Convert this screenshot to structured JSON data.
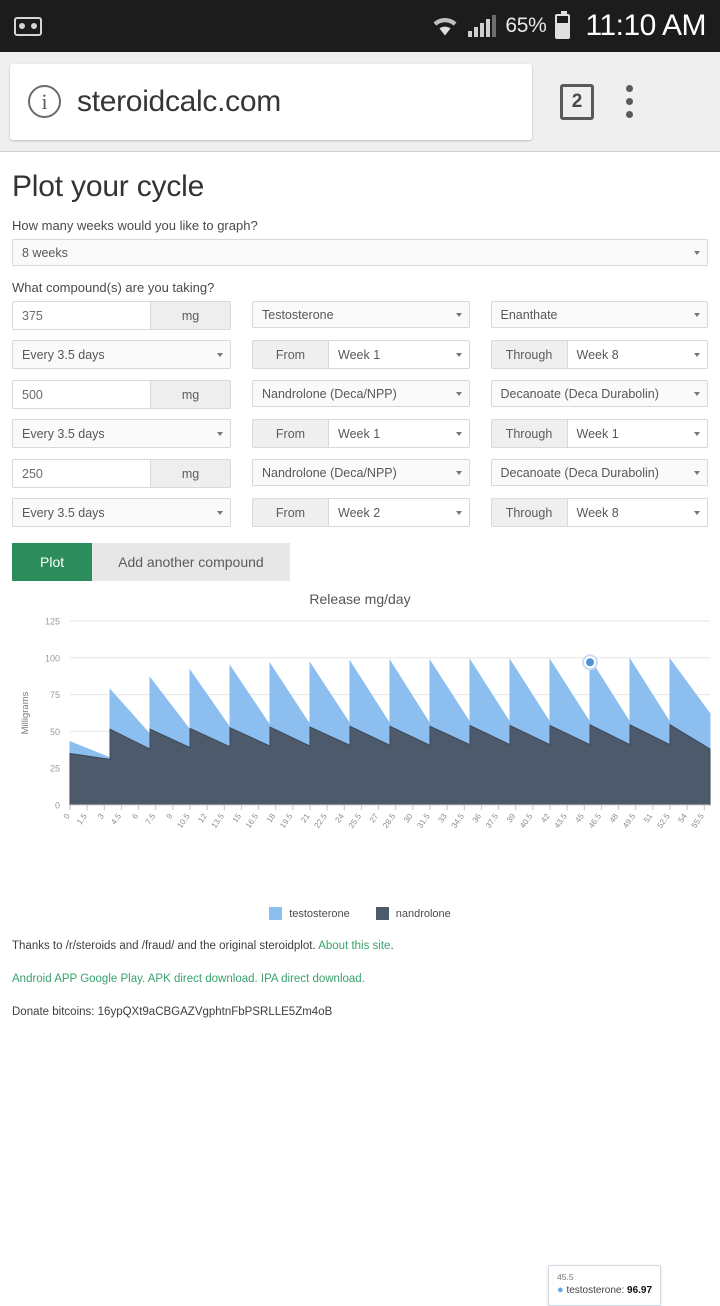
{
  "statusbar": {
    "voicemail_icon": "voicemail-icon",
    "wifi_icon": "wifi-icon",
    "signal_icon": "cell-signal-icon",
    "battery_percent": "65%",
    "battery_icon": "battery-icon",
    "time": "11:10 AM"
  },
  "browser": {
    "info_icon": "info-icon",
    "url": "steroidcalc.com",
    "tab_count": "2",
    "menu_icon": "overflow-menu-icon"
  },
  "page": {
    "title": "Plot your cycle",
    "weeks_question": "How many weeks would you like to graph?",
    "weeks_value": "8 weeks",
    "compound_question": "What compound(s) are you taking?"
  },
  "compounds": [
    {
      "dose": "375",
      "unit": "mg",
      "compound": "Testosterone",
      "ester": "Enanthate",
      "schedule": "Every 3.5 days",
      "from_label": "From",
      "from_week": "Week 1",
      "through_label": "Through",
      "through_week": "Week 8"
    },
    {
      "dose": "500",
      "unit": "mg",
      "compound": "Nandrolone (Deca/NPP)",
      "ester": "Decanoate (Deca Durabolin)",
      "schedule": "Every 3.5 days",
      "from_label": "From",
      "from_week": "Week 1",
      "through_label": "Through",
      "through_week": "Week 1"
    },
    {
      "dose": "250",
      "unit": "mg",
      "compound": "Nandrolone (Deca/NPP)",
      "ester": "Decanoate (Deca Durabolin)",
      "schedule": "Every 3.5 days",
      "from_label": "From",
      "from_week": "Week 2",
      "through_label": "Through",
      "through_week": "Week 8"
    }
  ],
  "buttons": {
    "plot": "Plot",
    "add_compound": "Add another compound",
    "plot_color": "#2c8c5c"
  },
  "tooltip": {
    "x_value": "45.5",
    "series_label": "testosterone:",
    "series_value": "96.97"
  },
  "footer": {
    "line1_pre": "Thanks to /r/steroids and /fraud/ and the original steroidplot. ",
    "line1_link": "About this site",
    "line1_post": ".",
    "line2": "Android APP Google Play. APK direct download. IPA direct download.",
    "line3": "Donate bitcoins: 16ypQXt9aCBGAZVgphtnFbPSRLLE5Zm4oB",
    "link_color": "#39a26b"
  },
  "chart_data": {
    "type": "area",
    "stacked": true,
    "title": "Release mg/day",
    "xlabel": "",
    "ylabel": "Milligrams",
    "ylim": [
      0,
      125
    ],
    "yticks": [
      0,
      25,
      50,
      75,
      100,
      125
    ],
    "xlim": [
      0,
      56
    ],
    "xticks": [
      0,
      1.5,
      3,
      4.5,
      6,
      7.5,
      9,
      10.5,
      12,
      13.5,
      15,
      16.5,
      18,
      19.5,
      21,
      22.5,
      24,
      25.5,
      27,
      28.5,
      30,
      31.5,
      33,
      34.5,
      36,
      37.5,
      39,
      40.5,
      42,
      43.5,
      45,
      46.5,
      48,
      49.5,
      51,
      52.5,
      54,
      55.5
    ],
    "grid": true,
    "legend_position": "bottom",
    "colors": {
      "testosterone": "#8cbef0",
      "nandrolone": "#4d5a6b"
    },
    "series": [
      {
        "name": "nandrolone",
        "color": "#4d5a6b",
        "x": [
          0,
          3.5,
          3.5,
          7,
          7,
          10.5,
          10.5,
          14,
          14,
          17.5,
          17.5,
          21,
          21,
          24.5,
          24.5,
          28,
          28,
          31.5,
          31.5,
          35,
          35,
          38.5,
          38.5,
          42,
          42,
          45.5,
          45.5,
          49,
          49,
          52.5,
          52.5,
          56
        ],
        "y": [
          35,
          31,
          51.5,
          38,
          51.5,
          39,
          52,
          39.5,
          52.5,
          40,
          53,
          40,
          53,
          40.5,
          53.5,
          40.5,
          53.5,
          40.5,
          53.5,
          41,
          54,
          41,
          54,
          41,
          54,
          41,
          54.5,
          41,
          54.5,
          41,
          54.5,
          38
        ]
      },
      {
        "name": "testosterone",
        "color": "#8cbef0",
        "x": [
          0,
          3.5,
          3.5,
          7,
          7,
          10.5,
          10.5,
          14,
          14,
          17.5,
          17.5,
          21,
          21,
          24.5,
          24.5,
          28,
          28,
          31.5,
          31.5,
          35,
          35,
          38.5,
          38.5,
          42,
          42,
          45.5,
          45.5,
          49,
          49,
          52.5,
          52.5,
          56
        ],
        "y": [
          8,
          1,
          27,
          10,
          35,
          12,
          39.5,
          13,
          42,
          14,
          43,
          14.5,
          43.5,
          14.5,
          44,
          14.5,
          44.5,
          14.5,
          44.5,
          15,
          44.5,
          15,
          44.5,
          15,
          44.5,
          15,
          44.5,
          15,
          44.5,
          15,
          44.5,
          24
        ]
      }
    ],
    "highlight_point": {
      "x": 45.5,
      "y": 96.97,
      "series": "testosterone"
    }
  }
}
